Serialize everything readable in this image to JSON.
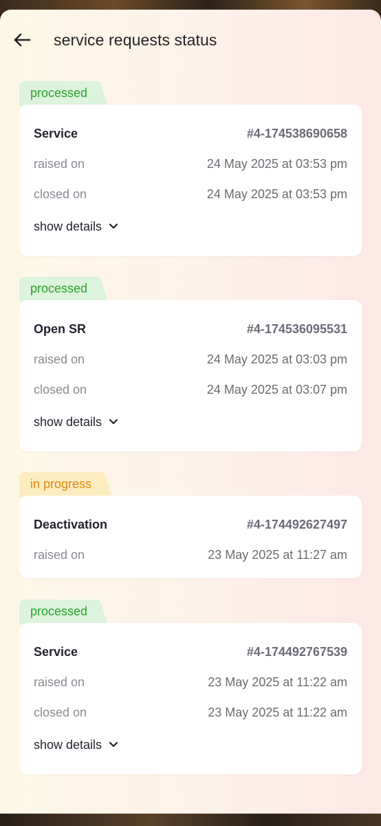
{
  "header": {
    "title": "service requests status"
  },
  "requests": [
    {
      "status": "processed",
      "name": "Service",
      "id": "#4-174538690658",
      "raised_label": "raised on",
      "raised": "24 May 2025 at 03:53 pm",
      "closed_label": "closed on",
      "closed": "24 May 2025 at 03:53 pm",
      "details_label": "show details"
    },
    {
      "status": "processed",
      "name": "Open SR",
      "id": "#4-174536095531",
      "raised_label": "raised on",
      "raised": "24 May 2025 at 03:03 pm",
      "closed_label": "closed on",
      "closed": "24 May 2025 at 03:07 pm",
      "details_label": "show details"
    },
    {
      "status": "in progress",
      "name": "Deactivation",
      "id": "#4-174492627497",
      "raised_label": "raised on",
      "raised": "23 May 2025 at 11:27 am"
    },
    {
      "status": "processed",
      "name": "Service",
      "id": "#4-174492767539",
      "raised_label": "raised on",
      "raised": "23 May 2025 at 11:22 am",
      "closed_label": "closed on",
      "closed": "23 May 2025 at 11:22 am",
      "details_label": "show details"
    }
  ],
  "colors": {
    "processed_text": "#2aa32a",
    "processed_bg": "#dcf3dc",
    "in_progress_text": "#e08a12",
    "in_progress_bg": "#fcecc0"
  },
  "icons": {
    "back": "back-arrow-icon",
    "expand": "chevron-down-icon"
  }
}
